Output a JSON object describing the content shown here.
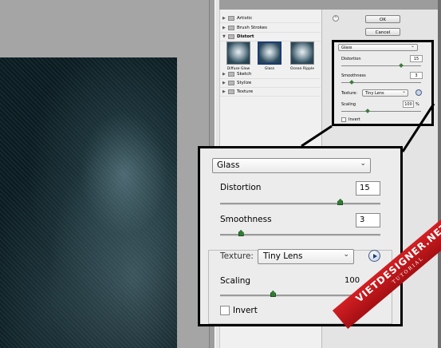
{
  "gallery": {
    "categories": [
      {
        "label": "Artistic",
        "expanded": false
      },
      {
        "label": "Brush Strokes",
        "expanded": false
      },
      {
        "label": "Distort",
        "expanded": true
      },
      {
        "label": "Sketch",
        "expanded": false
      },
      {
        "label": "Stylize",
        "expanded": false
      },
      {
        "label": "Texture",
        "expanded": false
      }
    ],
    "thumbnails": [
      {
        "label": "Diffuse Glow",
        "selected": false
      },
      {
        "label": "Glass",
        "selected": true
      },
      {
        "label": "Ocean Ripple",
        "selected": false
      }
    ]
  },
  "buttons": {
    "ok": "OK",
    "cancel": "Cancel"
  },
  "settings": {
    "filter": "Glass",
    "distortion_label": "Distortion",
    "distortion_value": "15",
    "distortion_fraction": 0.75,
    "smoothness_label": "Smoothness",
    "smoothness_value": "3",
    "smoothness_fraction": 0.13,
    "texture_label": "Texture:",
    "texture_value": "Tiny Lens",
    "scaling_label": "Scaling",
    "scaling_value": "100",
    "scaling_unit": "%",
    "scaling_fraction": 0.33,
    "invert_label": "Invert",
    "invert_checked": false
  },
  "watermark": {
    "main": "VIETDESIGNER.NET",
    "sub": "TUTORIAL"
  },
  "colors": {
    "slider_thumb": "#2e7d32",
    "watermark": "#c0181c",
    "preview_bg": "#0a1c22"
  }
}
